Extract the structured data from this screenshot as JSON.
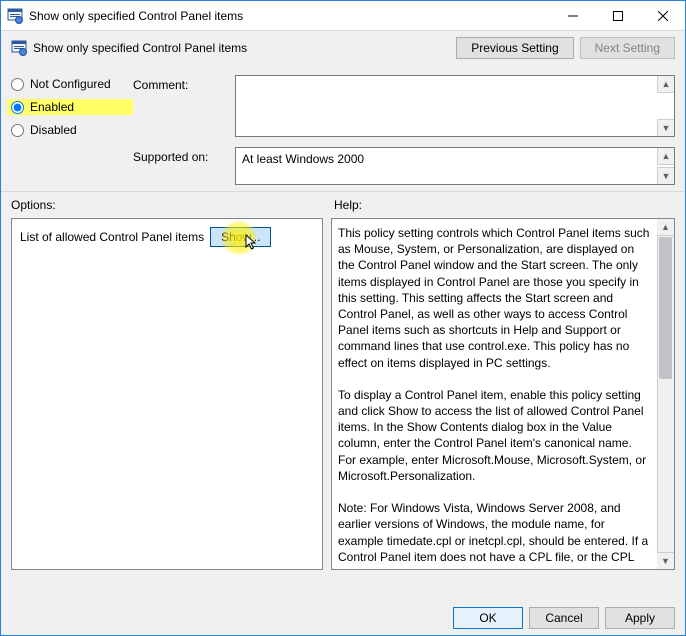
{
  "window": {
    "title": "Show only specified Control Panel items",
    "header_title": "Show only specified Control Panel items"
  },
  "nav": {
    "prev": "Previous Setting",
    "next": "Next Setting"
  },
  "state": {
    "not_configured": "Not Configured",
    "enabled": "Enabled",
    "disabled": "Disabled",
    "selected": "enabled"
  },
  "labels": {
    "comment": "Comment:",
    "supported": "Supported on:",
    "options": "Options:",
    "help": "Help:"
  },
  "supported_text": "At least Windows 2000",
  "options": {
    "list_label": "List of allowed Control Panel items",
    "show_btn": "Show..."
  },
  "help_text": "This policy setting controls which Control Panel items such as Mouse, System, or Personalization, are displayed on the Control Panel window and the Start screen. The only items displayed in Control Panel are those you specify in this setting. This setting affects the Start screen and Control Panel, as well as other ways to access Control Panel items such as shortcuts in Help and Support or command lines that use control.exe. This policy has no effect on items displayed in PC settings.\n\nTo display a Control Panel item, enable this policy setting and click Show to access the list of allowed Control Panel items. In the Show Contents dialog box in the Value column, enter the Control Panel item's canonical name. For example, enter Microsoft.Mouse, Microsoft.System, or Microsoft.Personalization.\n\nNote: For Windows Vista, Windows Server 2008, and earlier versions of Windows, the module name, for example timedate.cpl or inetcpl.cpl, should be entered. If a Control Panel item does not have a CPL file, or the CPL file contains multiple applets, then its module name and string resource identification",
  "buttons": {
    "ok": "OK",
    "cancel": "Cancel",
    "apply": "Apply"
  }
}
